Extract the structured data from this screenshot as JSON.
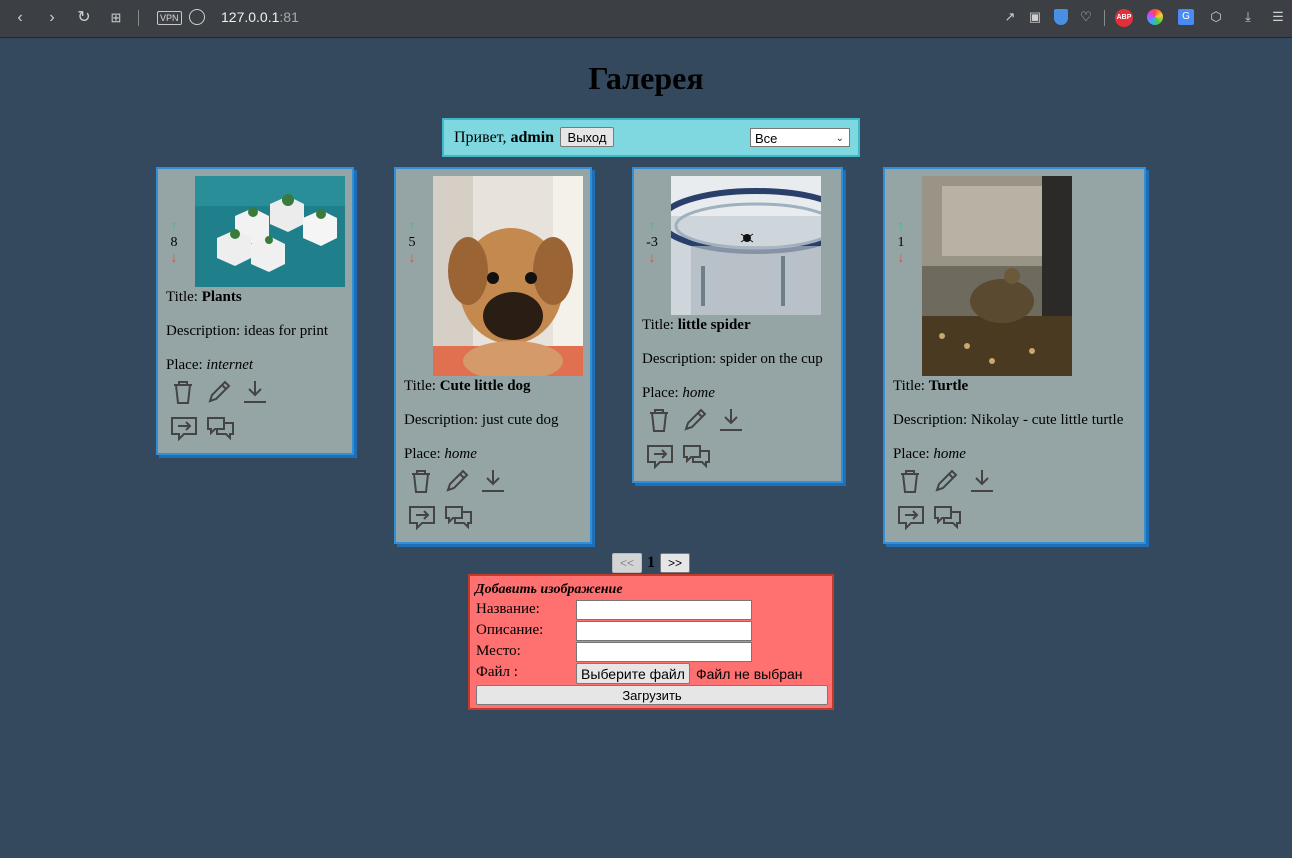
{
  "browser": {
    "vpn_label": "VPN",
    "url_host": "127.0.0.1",
    "url_port": ":81",
    "abp_label": "ABP",
    "translate_label": "G"
  },
  "page": {
    "title": "Галерея"
  },
  "userbar": {
    "greeting": "Привет,",
    "username": "admin",
    "logout_label": "Выход",
    "filter_selected": "Все"
  },
  "cards": [
    {
      "rating": "8",
      "title_label": "Title:",
      "title": "Plants",
      "desc_label": "Description:",
      "desc": "ideas for print",
      "place_label": "Place:",
      "place": "internet",
      "image": "plants-photo"
    },
    {
      "rating": "5",
      "title_label": "Title:",
      "title": "Cute little dog",
      "desc_label": "Description:",
      "desc": "just cute dog",
      "place_label": "Place:",
      "place": "home",
      "image": "dog-photo"
    },
    {
      "rating": "-3",
      "title_label": "Title:",
      "title": "little spider",
      "desc_label": "Description:",
      "desc": "spider on the cup",
      "place_label": "Place:",
      "place": "home",
      "image": "spider-photo"
    },
    {
      "rating": "1",
      "title_label": "Title:",
      "title": "Turtle",
      "desc_label": "Description:",
      "desc": "Nikolay - cute little turtle",
      "place_label": "Place:",
      "place": "home",
      "image": "turtle-photo"
    }
  ],
  "pager": {
    "prev_label": "<<",
    "current": "1",
    "next_label": ">>"
  },
  "upload": {
    "heading": "Добавить изображение",
    "name_label": "Название:",
    "desc_label": "Описание:",
    "place_label": "Место:",
    "file_label": "Файл :",
    "file_button": "Выберите файл",
    "file_status": "Файл не выбран",
    "submit_label": "Загрузить"
  },
  "colors": {
    "background": "#34495e",
    "card": "#95a5a6",
    "card_border": "#2f8fd8",
    "userbar": "#7fd8e0",
    "upload": "#ff7070",
    "vote_up": "#2ecc71",
    "vote_down": "#e74c3c"
  }
}
